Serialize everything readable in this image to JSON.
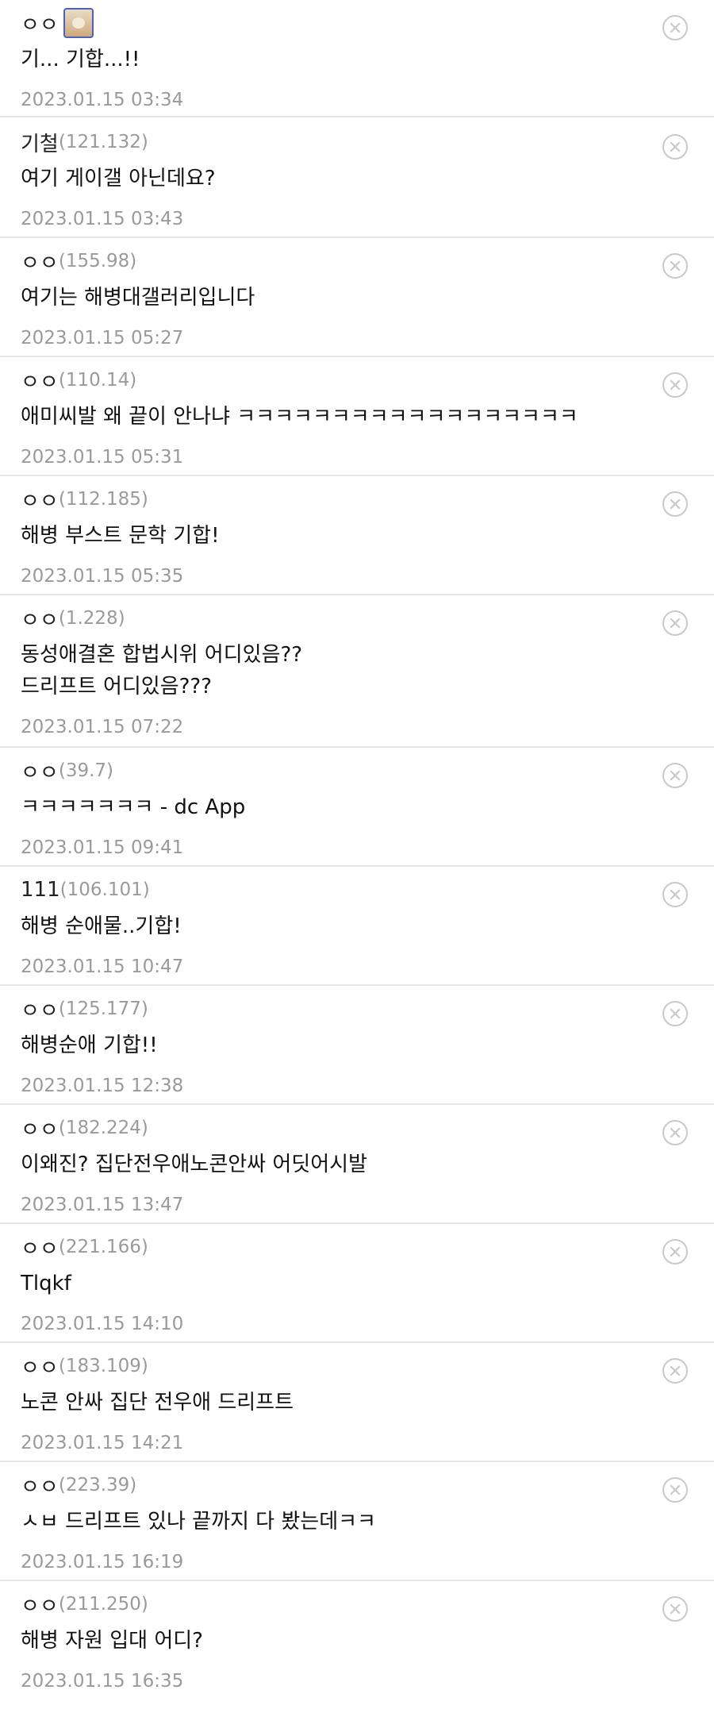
{
  "comments": [
    {
      "nick": "ㅇㅇ",
      "ip": "",
      "has_avatar": true,
      "lines": [
        "기... 기합...!!"
      ],
      "date": "2023.01.15 03:34"
    },
    {
      "nick": "기철",
      "ip": "(121.132)",
      "lines": [
        "여기 게이갤 아닌데요?"
      ],
      "date": "2023.01.15 03:43"
    },
    {
      "nick": "ㅇㅇ",
      "ip": "(155.98)",
      "lines": [
        "여기는 해병대갤러리입니다"
      ],
      "date": "2023.01.15 05:27"
    },
    {
      "nick": "ㅇㅇ",
      "ip": "(110.14)",
      "lines": [
        "애미씨발 왜 끝이 안나냐 ㅋㅋㅋㅋㅋㅋㅋㅋㅋㅋㅋㅋㅋㅋㅋㅋㅋㅋ"
      ],
      "date": "2023.01.15 05:31"
    },
    {
      "nick": "ㅇㅇ",
      "ip": "(112.185)",
      "lines": [
        "해병 부스트 문학 기합!"
      ],
      "date": "2023.01.15 05:35"
    },
    {
      "nick": "ㅇㅇ",
      "ip": "(1.228)",
      "lines": [
        "동성애결혼 합법시위 어디있음??",
        "드리프트 어디있음???"
      ],
      "date": "2023.01.15 07:22"
    },
    {
      "nick": "ㅇㅇ",
      "ip": "(39.7)",
      "lines": [
        "ㅋㅋㅋㅋㅋㅋㅋ - dc App"
      ],
      "date": "2023.01.15 09:41"
    },
    {
      "nick": "111",
      "ip": "(106.101)",
      "lines": [
        "해병 순애물..기합!"
      ],
      "date": "2023.01.15 10:47"
    },
    {
      "nick": "ㅇㅇ",
      "ip": "(125.177)",
      "lines": [
        "해병순애 기합!!"
      ],
      "date": "2023.01.15 12:38"
    },
    {
      "nick": "ㅇㅇ",
      "ip": "(182.224)",
      "lines": [
        "이왜진? 집단전우애노콘안싸 어딧어시발"
      ],
      "date": "2023.01.15 13:47"
    },
    {
      "nick": "ㅇㅇ",
      "ip": "(221.166)",
      "lines": [
        "Tlqkf"
      ],
      "date": "2023.01.15 14:10"
    },
    {
      "nick": "ㅇㅇ",
      "ip": "(183.109)",
      "lines": [
        "노콘 안싸 집단 전우애 드리프트"
      ],
      "date": "2023.01.15 14:21"
    },
    {
      "nick": "ㅇㅇ",
      "ip": "(223.39)",
      "lines": [
        "ㅅㅂ 드리프트 있나 끝까지 다 봤는데ㅋㅋ"
      ],
      "date": "2023.01.15 16:19"
    },
    {
      "nick": "ㅇㅇ",
      "ip": "(211.250)",
      "lines": [
        "해병 자원 입대 어디?"
      ],
      "date": "2023.01.15 16:35"
    }
  ],
  "icons": {
    "delete": "close-circle-icon",
    "avatar": "puppy-avatar-icon"
  },
  "colors": {
    "divider": "#e6e6e6",
    "muted": "#9a9a9a",
    "text": "#111111",
    "icon": "#c9c9c9"
  }
}
